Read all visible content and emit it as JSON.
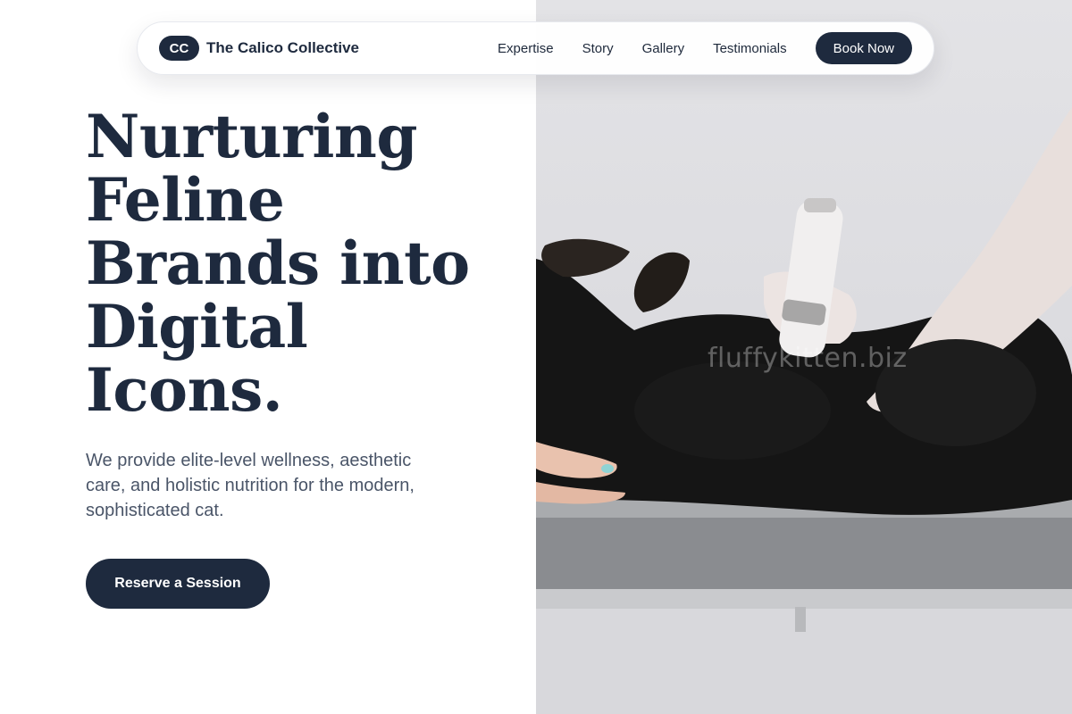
{
  "nav": {
    "logo_initials": "CC",
    "brand_name": "The Calico Collective",
    "links": [
      {
        "label": "Expertise"
      },
      {
        "label": "Story"
      },
      {
        "label": "Gallery"
      },
      {
        "label": "Testimonials"
      }
    ],
    "book_label": "Book Now"
  },
  "hero": {
    "headline": "Nurturing Feline Brands into Digital Icons.",
    "subtext": "We provide elite-level wellness, aesthetic care, and holistic nutrition for the modern, sophisticated cat.",
    "cta_label": "Reserve a Session"
  },
  "photo": {
    "watermark": "fluffykitten.biz",
    "subject": "black cat on its back being groomed with clippers on a metal table"
  },
  "colors": {
    "primary": "#1e2a3e",
    "text_body": "#4a5568",
    "background": "#ffffff"
  }
}
